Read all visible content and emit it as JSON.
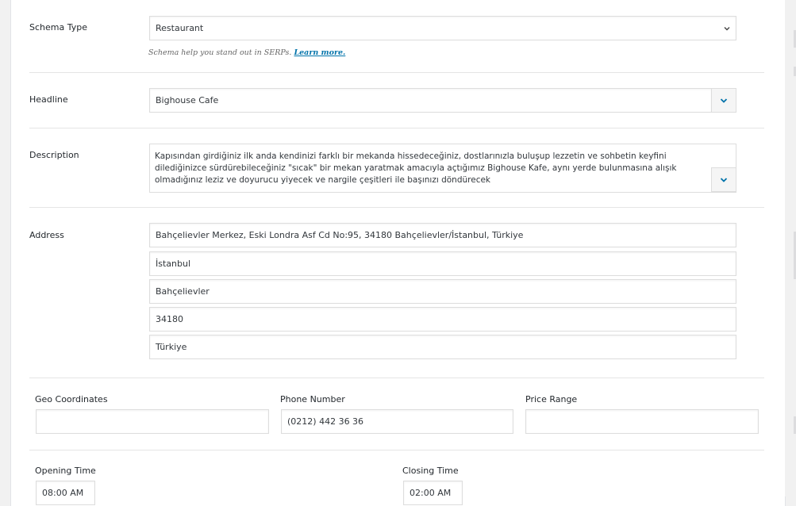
{
  "schema_type": {
    "label": "Schema Type",
    "value": "Restaurant",
    "help_text": "Schema help you stand out in SERPs.",
    "learn_more": "Learn more."
  },
  "headline": {
    "label": "Headline",
    "value": "Bighouse Cafe"
  },
  "description": {
    "label": "Description",
    "value": "Kapısından girdiğiniz ilk anda kendinizi farklı bir mekanda hissedeceğiniz, dostlarınızla buluşup lezzetin ve sohbetin keyfini dilediğinizce sürdürebileceğiniz \"sıcak\" bir mekan yaratmak amacıyla açtığımız Bighouse Kafe, aynı yerde bulunmasına alışık olmadığınız leziz ve doyurucu yiyecek ve nargile çeşitleri ile başınızı döndürecek"
  },
  "address": {
    "label": "Address",
    "street": "Bahçelievler Merkez, Eski Londra Asf Cd No:95, 34180 Bahçelievler/İstanbul, Türkiye",
    "city": "İstanbul",
    "district": "Bahçelievler",
    "postal_code": "34180",
    "country": "Türkiye"
  },
  "geo": {
    "label": "Geo Coordinates",
    "value": ""
  },
  "phone": {
    "label": "Phone Number",
    "value": "(0212) 442 36 36"
  },
  "price_range": {
    "label": "Price Range",
    "value": ""
  },
  "opening_time": {
    "label": "Opening Time",
    "value": "08:00 AM"
  },
  "closing_time": {
    "label": "Closing Time",
    "value": "02:00 AM"
  },
  "icons": {
    "select_arrow": "chevron-down-icon",
    "expand": "chevron-down-icon"
  },
  "colors": {
    "accent": "#0073aa",
    "border": "#dddddd",
    "background": "#f1f1f1"
  }
}
